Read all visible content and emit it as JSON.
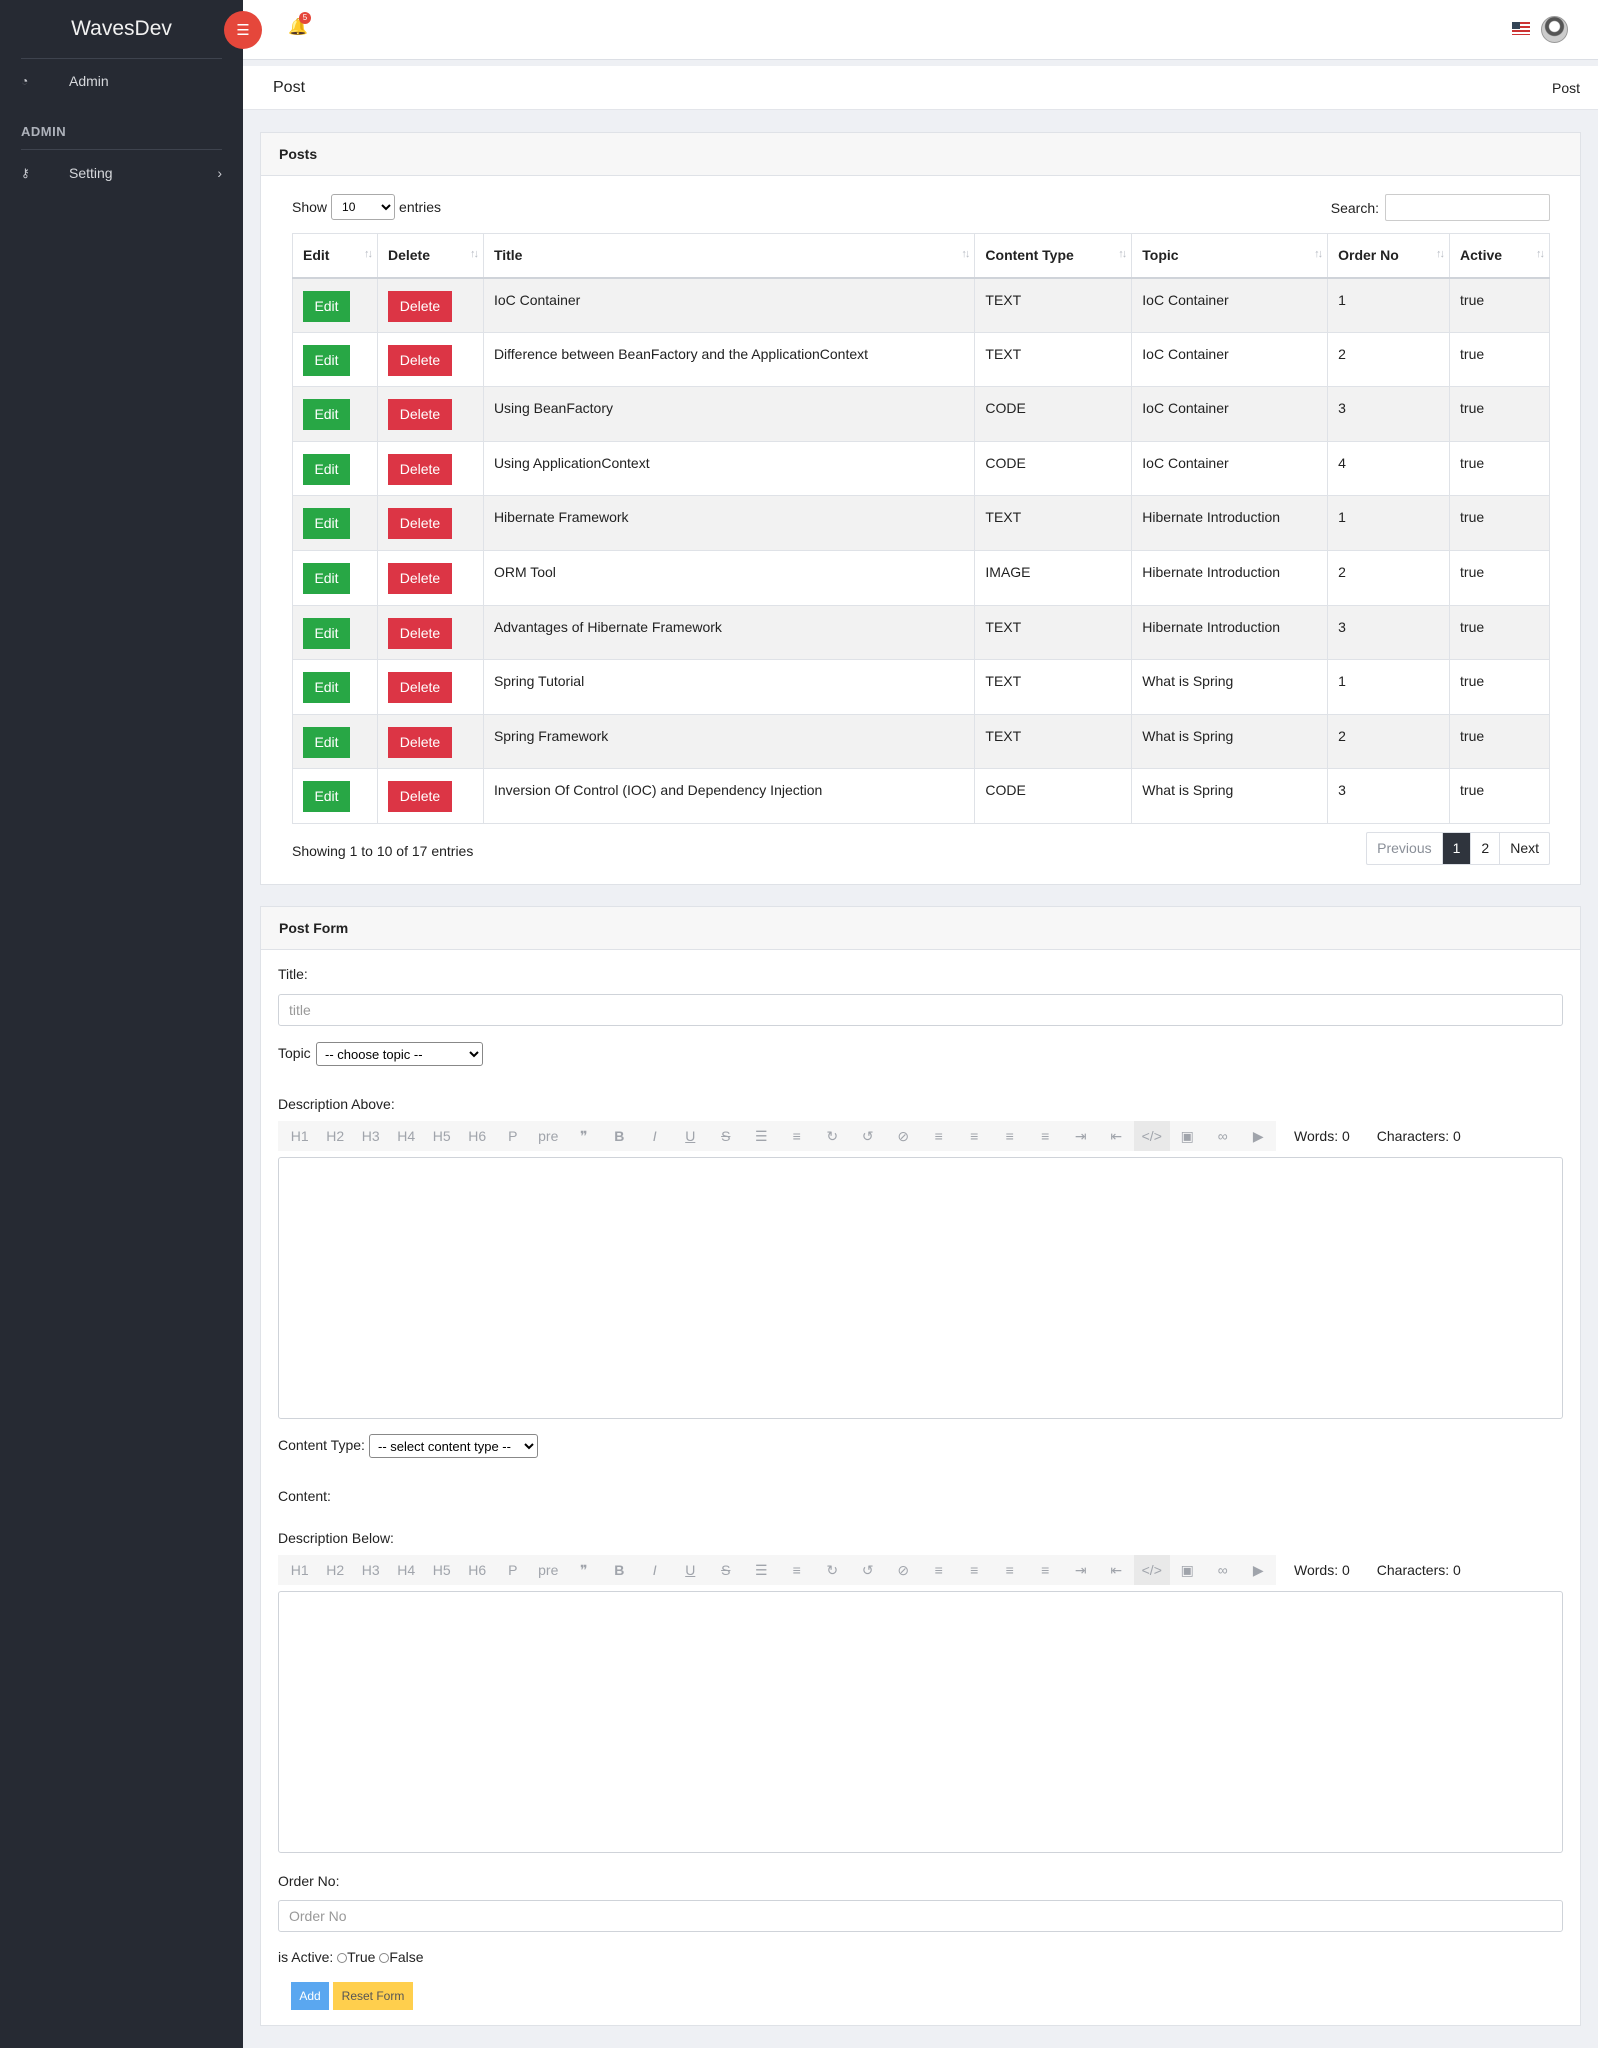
{
  "app": {
    "brand": "WavesDev",
    "notification_count": "5"
  },
  "sidebar": {
    "items": [
      {
        "label": "Admin",
        "icon": "dashboard-icon"
      }
    ],
    "section_title": "ADMIN",
    "section_items": [
      {
        "label": "Setting",
        "icon": "key-icon"
      }
    ]
  },
  "breadcrumb": {
    "title": "Post",
    "current": "Post"
  },
  "posts": {
    "header": "Posts",
    "show_label": "Show",
    "entries_label": "entries",
    "page_size": "10",
    "search_label": "Search:",
    "columns": [
      "Edit",
      "Delete",
      "Title",
      "Content Type",
      "Topic",
      "Order No",
      "Active"
    ],
    "edit_label": "Edit",
    "delete_label": "Delete",
    "rows": [
      {
        "title": "IoC Container",
        "type": "TEXT",
        "topic": "IoC Container",
        "order": "1",
        "active": "true"
      },
      {
        "title": "Difference between BeanFactory and the ApplicationContext",
        "type": "TEXT",
        "topic": "IoC Container",
        "order": "2",
        "active": "true"
      },
      {
        "title": "Using BeanFactory",
        "type": "CODE",
        "topic": "IoC Container",
        "order": "3",
        "active": "true"
      },
      {
        "title": "Using ApplicationContext",
        "type": "CODE",
        "topic": "IoC Container",
        "order": "4",
        "active": "true"
      },
      {
        "title": "Hibernate Framework",
        "type": "TEXT",
        "topic": "Hibernate Introduction",
        "order": "1",
        "active": "true"
      },
      {
        "title": "ORM Tool",
        "type": "IMAGE",
        "topic": "Hibernate Introduction",
        "order": "2",
        "active": "true"
      },
      {
        "title": "Advantages of Hibernate Framework",
        "type": "TEXT",
        "topic": "Hibernate Introduction",
        "order": "3",
        "active": "true"
      },
      {
        "title": "Spring Tutorial",
        "type": "TEXT",
        "topic": "What is Spring",
        "order": "1",
        "active": "true"
      },
      {
        "title": "Spring Framework",
        "type": "TEXT",
        "topic": "What is Spring",
        "order": "2",
        "active": "true"
      },
      {
        "title": "Inversion Of Control (IOC) and Dependency Injection",
        "type": "CODE",
        "topic": "What is Spring",
        "order": "3",
        "active": "true"
      }
    ],
    "info": "Showing 1 to 10 of 17 entries",
    "pager": {
      "previous": "Previous",
      "pages": [
        "1",
        "2"
      ],
      "next": "Next"
    }
  },
  "form": {
    "header": "Post Form",
    "title_label": "Title:",
    "title_placeholder": "title",
    "topic_label": "Topic",
    "topic_select": "-- choose topic --",
    "desc_above_label": "Description Above:",
    "content_type_label": "Content Type:",
    "content_type_select": "-- select content type --",
    "content_label": "Content:",
    "desc_below_label": "Description Below:",
    "order_label": "Order No:",
    "order_placeholder": "Order No",
    "active_label": "is Active:",
    "true_label": "True",
    "false_label": "False",
    "add_label": "Add",
    "reset_label": "Reset Form",
    "editor": {
      "tools": [
        "H1",
        "H2",
        "H3",
        "H4",
        "H5",
        "H6",
        "P",
        "pre",
        "❞",
        "B",
        "I",
        "U",
        "S",
        "☰",
        "≡",
        "↻",
        "↺",
        "⊘",
        "≡",
        "≡",
        "≡",
        "≡",
        "⇥",
        "⇤",
        "</>",
        "▣",
        "∞",
        "▶"
      ],
      "words": "Words: 0",
      "characters": "Characters: 0"
    }
  }
}
